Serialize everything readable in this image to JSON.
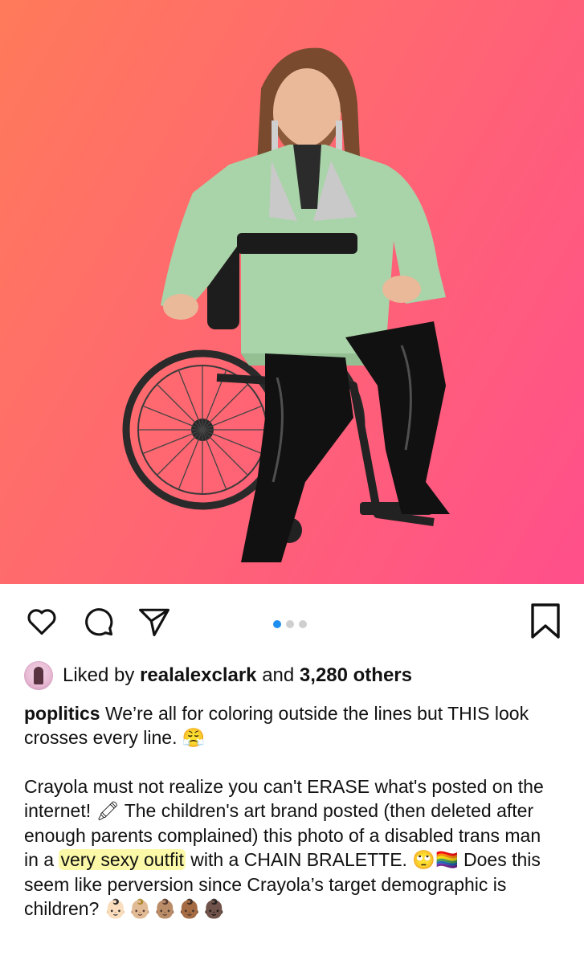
{
  "post": {
    "image_alt": "",
    "carousel": {
      "count": 3,
      "active": 0
    }
  },
  "actions": {
    "like_icon": "heart-icon",
    "comment_icon": "comment-icon",
    "share_icon": "paper-plane-icon",
    "save_icon": "bookmark-icon"
  },
  "likes": {
    "prefix": "Liked by",
    "user": "realalexclark",
    "connector": "and",
    "others": "3,280 others"
  },
  "caption": {
    "username": "poplitics",
    "line1": "We’re all for coloring outside the lines but THIS look crosses every line.",
    "emoji1": "😤",
    "para2_a": "Crayola must not realize you can't ERASE what's posted on the internet!",
    "emoji2": "🖍",
    "para2_b": "The children's art brand posted (then deleted after enough parents complained) this photo of a disabled trans man in a",
    "highlight": "very sexy outfit",
    "para2_c": "with a CHAIN BRALETTE.",
    "emoji3": "🙄🏳️‍🌈",
    "para2_d": "Does this seem like perversion since Crayola’s target demographic is children?",
    "emoji4": "👶🏻👶🏼👶🏽👶🏾👶🏿"
  },
  "colors": {
    "bg_start": "#ff7a5a",
    "bg_end": "#ff4f8b",
    "jacket": "#a9d3a8",
    "boots": "#111111",
    "dot_active": "#1f8ef1",
    "highlight": "#fbf9a8"
  }
}
